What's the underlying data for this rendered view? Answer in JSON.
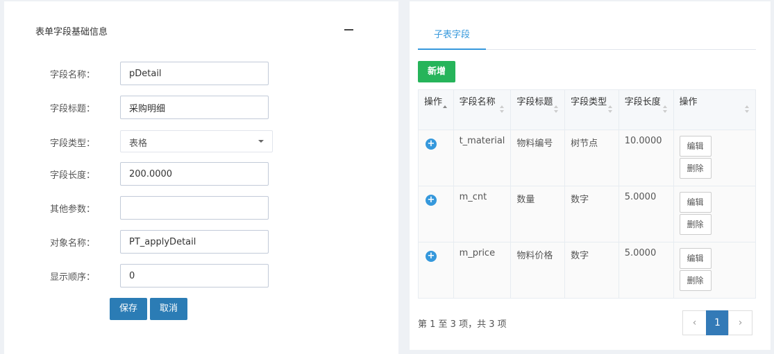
{
  "left_panel": {
    "title": "表单字段基础信息",
    "fields": [
      {
        "label": "字段名称：",
        "value": "pDetail"
      },
      {
        "label": "字段标题：",
        "value": "采购明细"
      },
      {
        "label": "字段类型：",
        "value": "表格"
      },
      {
        "label": "字段长度：",
        "value": "200.0000"
      },
      {
        "label": "其他参数：",
        "value": ""
      },
      {
        "label": "对象名称：",
        "value": "PT_applyDetail"
      },
      {
        "label": "显示顺序：",
        "value": "0"
      }
    ],
    "save_label": "保存",
    "cancel_label": "取消"
  },
  "right_panel": {
    "tab_label": "子表字段",
    "add_label": "新增",
    "table": {
      "headers": [
        "操作",
        "字段名称",
        "字段标题",
        "字段类型",
        "字段长度",
        "操作"
      ],
      "rows": [
        {
          "name": "t_material",
          "title": "物料编号",
          "type": "树节点",
          "length": "10.0000"
        },
        {
          "name": "m_cnt",
          "title": "数量",
          "type": "数字",
          "length": "5.0000"
        },
        {
          "name": "m_price",
          "title": "物料价格",
          "type": "数字",
          "length": "5.0000"
        }
      ],
      "edit_label": "编辑",
      "delete_label": "删除"
    },
    "page_info": "第 1 至 3 项，共 3 项",
    "pagination": {
      "prev": "‹",
      "current": "1",
      "next": "›"
    }
  },
  "colors": {
    "primary": "#337ab7",
    "success": "#26b45a",
    "tab_accent": "#3598dc"
  }
}
